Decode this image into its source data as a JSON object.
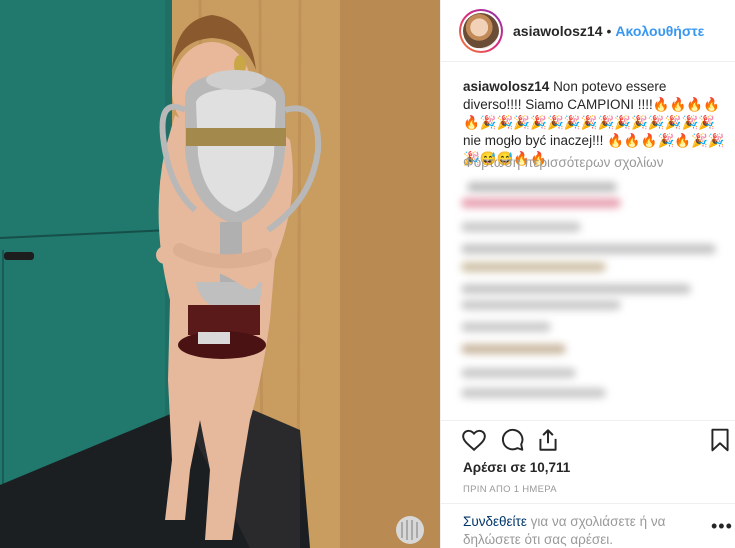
{
  "post": {
    "username": "asiawolosz14",
    "separator": "•",
    "follow_label": "Ακολουθήστε",
    "caption_user": "asiawolosz14",
    "caption_text": "Non potevo essere diverso!!!! Siamo CAMPIONI !!!!🔥🔥🔥🔥🔥🎉🎉🎉🎉🎉🎉🎉🎉🎉🎉🎉🎉🎉🎉 nie mogło być inaczej!!! 🔥🔥🔥🎉🔥🎉🎉🎉😅😅🔥🔥",
    "load_more": "Φόρτωση περισσότερων σχολίων",
    "likes": "Αρέσει σε 10,711",
    "time": "ΠΡΙΝ ΑΠΟ 1 ΗΜΕΡΑ",
    "login_link": "Συνδεθείτε",
    "login_text": " για να σχολιάσετε ή να δηλώσετε ότι σας αρέσει.",
    "more_label": "•••"
  },
  "icons": {
    "like": "heart-icon",
    "comment": "comment-icon",
    "share": "share-icon",
    "save": "bookmark-icon"
  },
  "colors": {
    "link": "#3897f0",
    "text": "#262626",
    "muted": "#999999",
    "login": "#003569"
  }
}
